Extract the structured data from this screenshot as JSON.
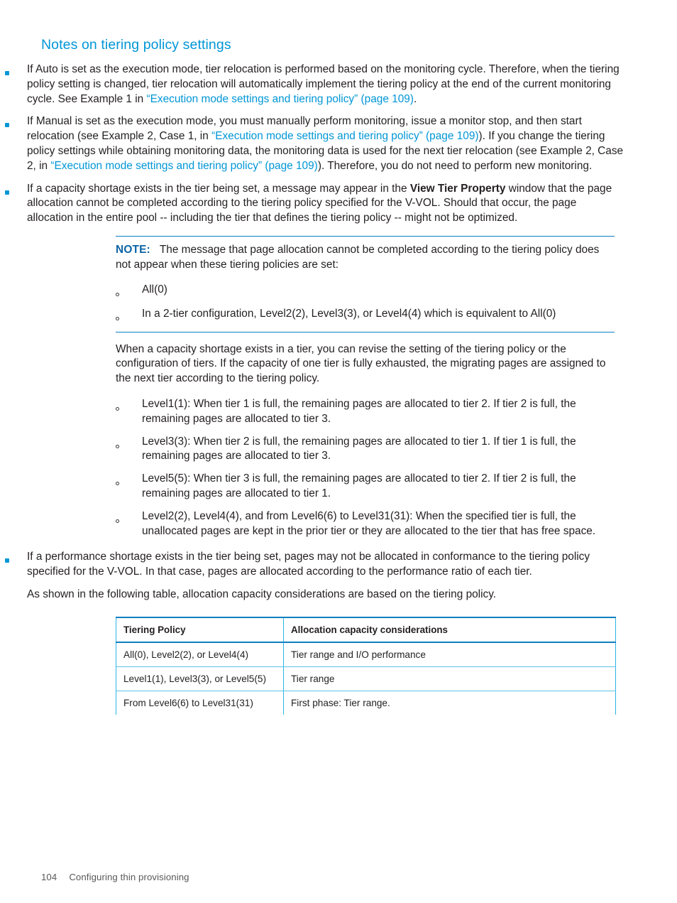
{
  "heading": "Notes on tiering policy settings",
  "bullets": {
    "auto_mode": {
      "text_1": "If Auto is set as the execution mode, tier relocation is performed based on the monitoring cycle. Therefore, when the tiering policy setting is changed, tier relocation will automatically implement the tiering policy at the end of the current monitoring cycle. See Example 1 in ",
      "link_1": "“Execution mode settings and tiering policy” (page 109)",
      "text_2": "."
    },
    "manual_mode": {
      "text_1": "If Manual is set as the execution mode, you must manually perform monitoring, issue a monitor stop, and then start relocation (see Example 2, Case 1, in ",
      "link_1": "“Execution mode settings and tiering policy” (page 109)",
      "text_2": "). If you change the tiering policy settings while obtaining monitoring data, the monitoring data is used for the next tier relocation (see Example 2, Case 2, in ",
      "link_2": "“Execution mode settings and tiering policy” (page 109)",
      "text_3": "). Therefore, you do not need to perform new monitoring."
    },
    "capacity_shortage": {
      "text_1": "If a capacity shortage exists in the tier being set, a message may appear in the ",
      "bold_1": "View Tier Property",
      "text_2": " window that the page allocation cannot be completed according to the tiering policy specified for the V-VOL. Should that occur, the page allocation in the entire pool -- including the tier that defines the tiering policy -- might not be optimized."
    },
    "performance_shortage": {
      "text_1": "If a performance shortage exists in the tier being set, pages may not be allocated in conformance to the tiering policy specified for the V-VOL. In that case, pages are allocated according to the performance ratio of each tier.",
      "text_2": "As shown in the following table, allocation capacity considerations are based on the tiering policy."
    }
  },
  "note": {
    "label": "NOTE:",
    "body": "The message that page allocation cannot be completed according to the tiering policy does not appear when these tiering policies are set:",
    "items": [
      "All(0)",
      "In a 2-tier configuration, Level2(2), Level3(3), or Level4(4) which is equivalent to All(0)"
    ]
  },
  "capacity_paragraph": "When a capacity shortage exists in a tier, you can revise the setting of the tiering policy or the configuration of tiers. If the capacity of one tier is fully exhausted, the migrating pages are assigned to the next tier according to the tiering policy.",
  "level_items": [
    "Level1(1): When tier 1 is full, the remaining pages are allocated to tier 2. If tier 2 is full, the remaining pages are allocated to tier 3.",
    "Level3(3): When tier 2 is full, the remaining pages are allocated to tier 1. If tier 1 is full, the remaining pages are allocated to tier 3.",
    "Level5(5): When tier 3 is full, the remaining pages are allocated to tier 2. If tier 2 is full, the remaining pages are allocated to tier 1.",
    "Level2(2), Level4(4), and from Level6(6) to Level31(31): When the specified tier is full, the unallocated pages are kept in the prior tier or they are allocated to the tier that has free space."
  ],
  "table": {
    "headers": [
      "Tiering Policy",
      "Allocation capacity considerations"
    ],
    "rows": [
      [
        "All(0), Level2(2), or Level4(4)",
        "Tier range and I/O performance"
      ],
      [
        "Level1(1), Level3(3), or Level5(5)",
        "Tier range"
      ],
      [
        "From Level6(6) to Level31(31)",
        "First phase: Tier range."
      ]
    ]
  },
  "footer": {
    "page_number": "104",
    "chapter": "Configuring thin provisioning"
  },
  "colors": {
    "heading": "#0096d6",
    "link": "#0096d6",
    "note_label": "#0b63a5",
    "rule": "#0e7fc1",
    "table_border": "#2bb3e5",
    "body_text": "#231f20",
    "footer_text": "#58585b"
  }
}
